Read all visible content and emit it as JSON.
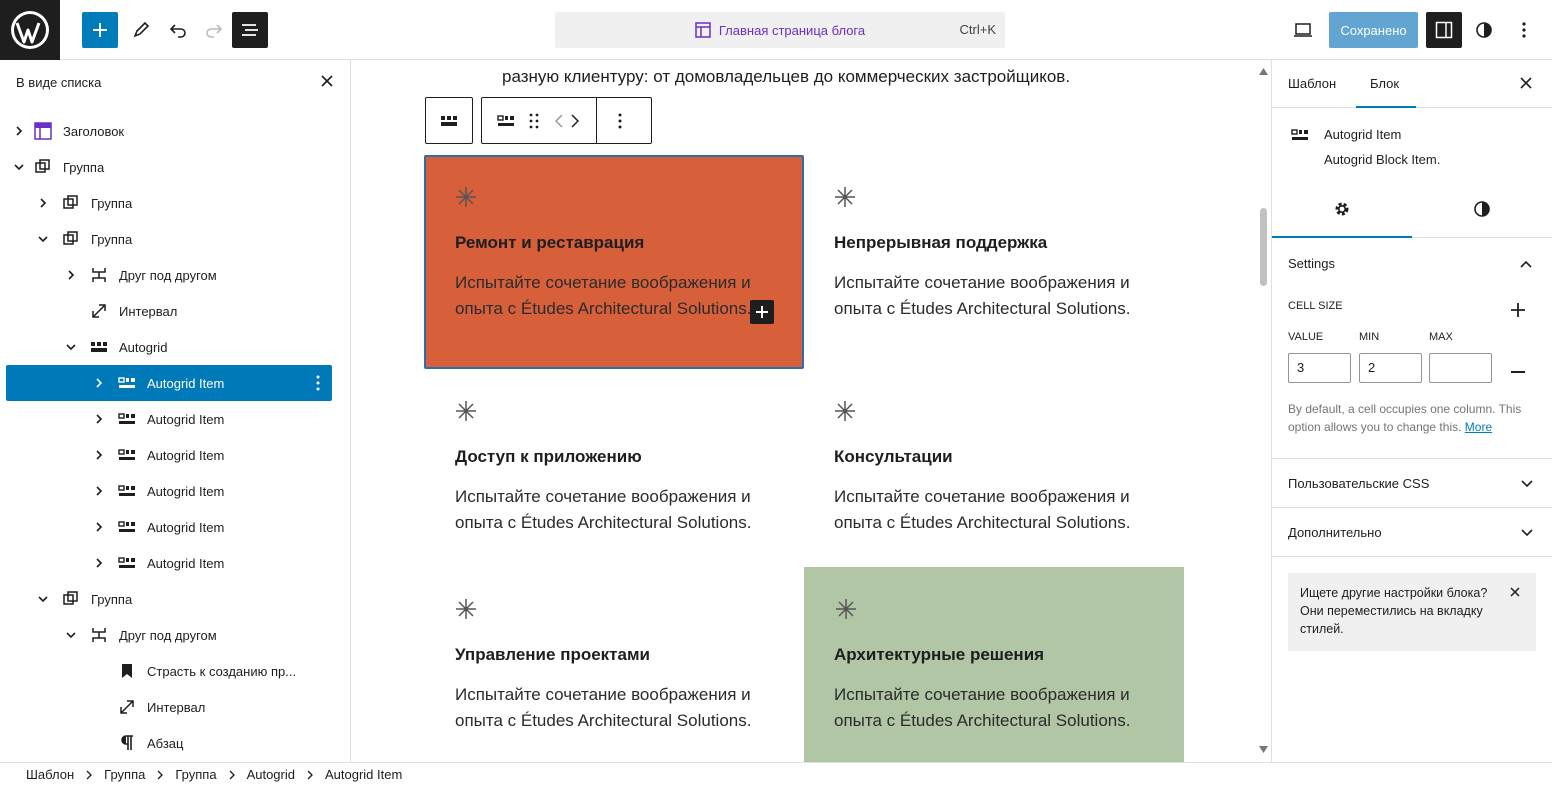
{
  "header": {
    "command_title": "Главная страница блога",
    "command_shortcut": "Ctrl+K",
    "save_label": "Сохранено"
  },
  "list_view": {
    "title": "В виде списка",
    "items": [
      {
        "label": "Заголовок"
      },
      {
        "label": "Группа"
      },
      {
        "label": "Группа"
      },
      {
        "label": "Группа"
      },
      {
        "label": "Друг под другом"
      },
      {
        "label": "Интервал"
      },
      {
        "label": "Autogrid"
      },
      {
        "label": "Autogrid Item"
      },
      {
        "label": "Autogrid Item"
      },
      {
        "label": "Autogrid Item"
      },
      {
        "label": "Autogrid Item"
      },
      {
        "label": "Autogrid Item"
      },
      {
        "label": "Autogrid Item"
      },
      {
        "label": "Группа"
      },
      {
        "label": "Друг под другом"
      },
      {
        "label": "Страсть к созданию пр..."
      },
      {
        "label": "Интервал"
      },
      {
        "label": "Абзац"
      }
    ]
  },
  "canvas": {
    "intro_text": "разную клиентуру: от домовладельцев до коммерческих застройщиков.",
    "cards": [
      {
        "title": "Ремонт и реставрация",
        "desc": "Испытайте сочетание воображения и опыта с Études Architectural Solutions."
      },
      {
        "title": "Непрерывная поддержка",
        "desc": "Испытайте сочетание воображения и опыта с Études Architectural Solutions."
      },
      {
        "title": "Доступ к приложению",
        "desc": "Испытайте сочетание воображения и опыта с Études Architectural Solutions."
      },
      {
        "title": "Консультации",
        "desc": "Испытайте сочетание воображения и опыта с Études Architectural Solutions."
      },
      {
        "title": "Управление проектами",
        "desc": "Испытайте сочетание воображения и опыта с Études Architectural Solutions."
      },
      {
        "title": "Архитектурные решения",
        "desc": "Испытайте сочетание воображения и опыта с Études Architectural Solutions."
      }
    ],
    "colors": {
      "selected_card": "#d75f3a",
      "green_card": "#b1c6a4"
    }
  },
  "sidebar": {
    "tabs": [
      "Шаблон",
      "Блок"
    ],
    "block_name": "Autogrid Item",
    "block_desc": "Autogrid Block Item.",
    "settings_title": "Settings",
    "cell_size_label": "CELL SIZE",
    "value_label": "VALUE",
    "min_label": "MIN",
    "max_label": "MAX",
    "value": "3",
    "min": "2",
    "max": "",
    "help_text": "By default, a cell occupies one column. This option allows you to change this.",
    "help_link": "More",
    "custom_css": "Пользовательские CSS",
    "advanced": "Дополнительно",
    "notice": "Ищете другие настройки блока? Они переместились на вкладку стилей."
  },
  "breadcrumbs": [
    "Шаблон",
    "Группа",
    "Группа",
    "Autogrid",
    "Autogrid Item"
  ]
}
